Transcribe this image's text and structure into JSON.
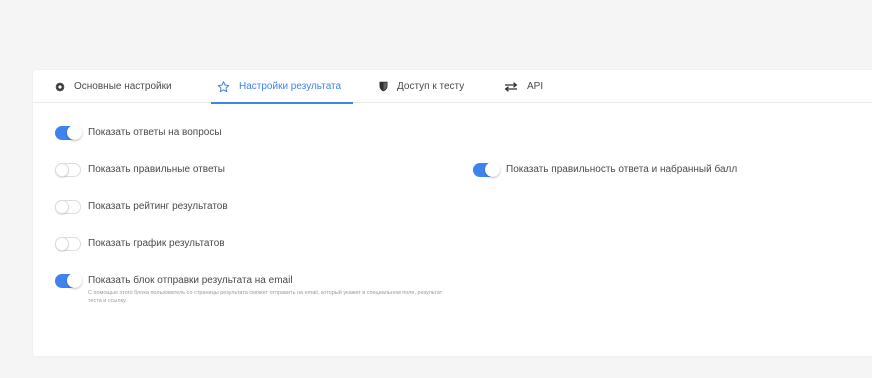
{
  "tabs": [
    {
      "label": "Основные настройки",
      "icon": "gear-icon",
      "active": false
    },
    {
      "label": "Настройки результата",
      "icon": "star-icon",
      "active": true
    },
    {
      "label": "Доступ к тесту",
      "icon": "shield-icon",
      "active": false
    },
    {
      "label": "API",
      "icon": "arrows-exchange-icon",
      "active": false
    }
  ],
  "options": [
    {
      "label": "Показать ответы на вопросы",
      "enabled": true
    },
    {
      "label": "Показать правильные ответы",
      "enabled": false
    },
    {
      "label": "Показать правильность ответа и набранный балл",
      "enabled": true
    },
    {
      "label": "Показать рейтинг результатов",
      "enabled": false
    },
    {
      "label": "Показать график результатов",
      "enabled": false
    },
    {
      "label": "Показать блок отправки результата на email",
      "enabled": true,
      "description": "С помощью этого блока пользователь со страницы результата сможет отправить на email, который укажет в специальном поле, результат теста и ссылку."
    }
  ],
  "colors": {
    "accent": "#3f83ee",
    "background": "#f5f5f6",
    "card": "#ffffff"
  }
}
